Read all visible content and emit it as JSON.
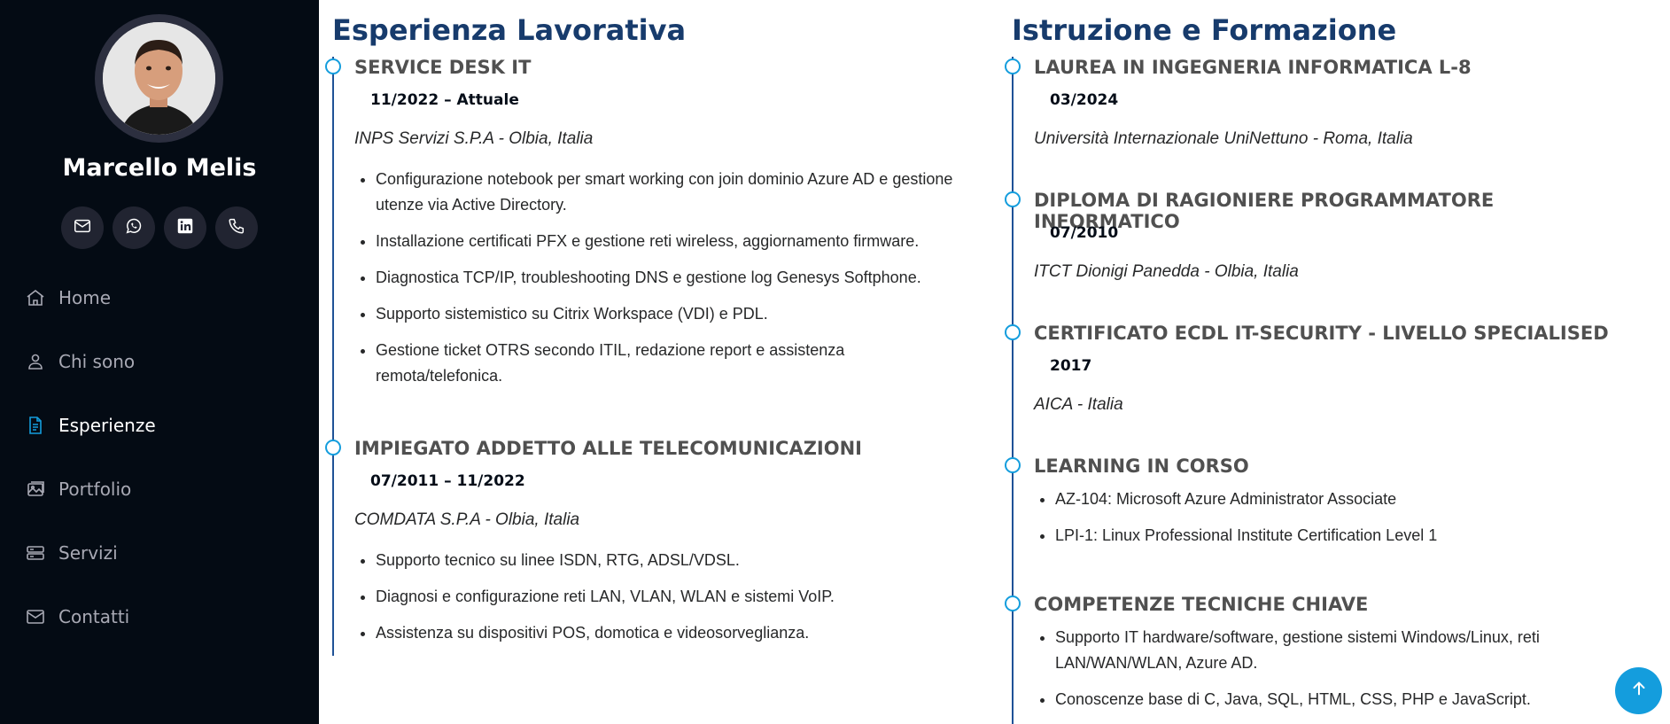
{
  "profile": {
    "name": "Marcello Melis"
  },
  "social": [
    {
      "icon": "envelope-icon"
    },
    {
      "icon": "whatsapp-icon"
    },
    {
      "icon": "linkedin-icon"
    },
    {
      "icon": "phone-icon"
    }
  ],
  "nav": {
    "items": [
      {
        "label": "Home",
        "icon": "home-icon",
        "active": false
      },
      {
        "label": "Chi sono",
        "icon": "person-icon",
        "active": false
      },
      {
        "label": "Esperienze",
        "icon": "file-text-icon",
        "active": true
      },
      {
        "label": "Portfolio",
        "icon": "images-icon",
        "active": false
      },
      {
        "label": "Servizi",
        "icon": "server-icon",
        "active": false
      },
      {
        "label": "Contatti",
        "icon": "envelope-icon",
        "active": false
      }
    ]
  },
  "experience": {
    "title": "Esperienza Lavorativa",
    "items": [
      {
        "title": "SERVICE DESK IT",
        "date": "11/2022 – Attuale",
        "org": "INPS Servizi S.P.A - Olbia, Italia",
        "bullets": [
          "Configurazione notebook per smart working con join dominio Azure AD e gestione utenze via Active Directory.",
          "Installazione certificati PFX e gestione reti wireless, aggiornamento firmware.",
          "Diagnostica TCP/IP, troubleshooting DNS e gestione log Genesys Softphone.",
          "Supporto sistemistico su Citrix Workspace (VDI) e PDL.",
          "Gestione ticket OTRS secondo ITIL, redazione report e assistenza remota/telefonica."
        ]
      },
      {
        "title": "IMPIEGATO ADDETTO ALLE TELECOMUNICAZIONI",
        "date": "07/2011 – 11/2022",
        "org": "COMDATA S.P.A - Olbia, Italia",
        "bullets": [
          "Supporto tecnico su linee ISDN, RTG, ADSL/VDSL.",
          "Diagnosi e configurazione reti LAN, VLAN, WLAN e sistemi VoIP.",
          "Assistenza su dispositivi POS, domotica e videosorveglianza."
        ]
      }
    ]
  },
  "education": {
    "title": "Istruzione e Formazione",
    "items": [
      {
        "title": "LAUREA IN INGEGNERIA INFORMATICA L-8",
        "date": "03/2024",
        "org": "Università Internazionale UniNettuno - Roma, Italia"
      },
      {
        "title": "DIPLOMA DI RAGIONIERE PROGRAMMATORE INFORMATICO",
        "date": "07/2010",
        "org": "ITCT Dionigi Panedda - Olbia, Italia"
      },
      {
        "title": "CERTIFICATO ECDL IT-SECURITY - LIVELLO SPECIALISED",
        "date": "2017",
        "org": "AICA - Italia"
      },
      {
        "title": "LEARNING IN CORSO",
        "bullets": [
          "AZ-104: Microsoft Azure Administrator Associate",
          "LPI-1: Linux Professional Institute Certification Level 1"
        ]
      },
      {
        "title": "COMPETENZE TECNICHE CHIAVE",
        "bullets": [
          "Supporto IT hardware/software, gestione sistemi Windows/Linux, reti LAN/WAN/WLAN, Azure AD.",
          "Conoscenze base di C, Java, SQL, HTML, CSS, PHP e JavaScript."
        ]
      }
    ]
  },
  "colors": {
    "sidebar_bg": "#040b14",
    "accent": "#149ddd",
    "heading": "#173b6c",
    "timeline": "#1f5297"
  },
  "back_to_top": {
    "icon": "arrow-up-icon"
  }
}
